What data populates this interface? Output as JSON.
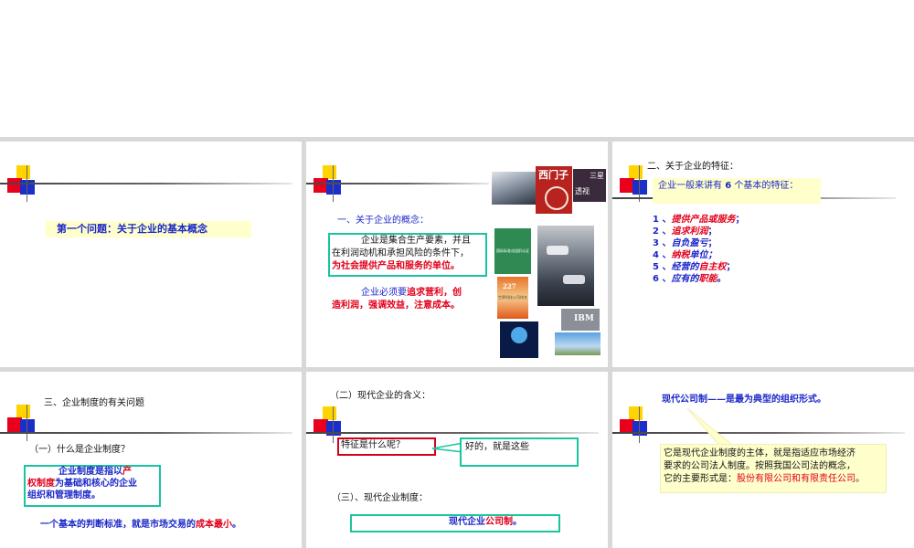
{
  "slides": {
    "s1": {
      "title": "第一个问题：关于企业的基本概念"
    },
    "s2": {
      "heading": "一、关于企业的概念：",
      "def_a": "企业是集合生产要素，并且",
      "def_b": "在利润动机和承担风险的条件下，",
      "def_c": "为社会提供产品和服务的单位。",
      "pursue_a1": "企业必须要",
      "pursue_a2": "追求营利，创",
      "pursue_b": "造利润，强调效益，注意成本。",
      "book_title": "西门子",
      "book_sub": "透视",
      "book_tag": "三星",
      "cert_text": "国际标准化组织认证",
      "cert2_text": "世界科技公司排名",
      "logo_text": "IBM"
    },
    "s3": {
      "heading": "二、关于企业的特征：",
      "intro_a": "企业一般来讲有",
      "intro_num": "6",
      "intro_b": "个基本的特征：",
      "features": [
        {
          "num": "1",
          "sep": "、",
          "label": "提供产品或服务",
          "tail": "；"
        },
        {
          "num": "2",
          "sep": "、",
          "label": "追求利润",
          "tail": "；"
        },
        {
          "num": "3",
          "sep": "、",
          "label": "自负盈亏",
          "tail": "；"
        },
        {
          "num": "4",
          "sep": "、",
          "label": "纳税",
          "tail": "单位；"
        },
        {
          "num": "5",
          "sep": "、",
          "label": "经营的",
          "label2": "自主权",
          "tail": "；"
        },
        {
          "num": "6",
          "sep": "、",
          "label": "应有的",
          "label2": "职能",
          "tail": "。"
        }
      ]
    },
    "s4": {
      "heading": "三、企业制度的有关问题",
      "q": "（一）什么是企业制度？",
      "def_a1": "企业制度是指以",
      "def_a2": "产",
      "def_b1": "权制度",
      "def_b2": "为基础和核心的企业",
      "def_c": "组织和管理制度。",
      "std_a": "一个基本的判断标准，就是市场交易的",
      "std_b": "成本最小",
      "std_c": "。"
    },
    "s5": {
      "heading": "（二）现代企业的含义：",
      "question": "特征是什么呢？",
      "answer": "好的，就是这些",
      "sub": "（三）、现代企业制度：",
      "box_a": "现代企业",
      "box_b": "公司制",
      "box_c": "。"
    },
    "s6": {
      "heading": "现代公司制——是最为典型的组织形式。",
      "body_a": "它是现代企业制度的主体，就是指适应市场经济",
      "body_b": "要求的公司法人制度。按照我国公司法的概念，",
      "body_c1": "它的主要形式是：",
      "body_c2": "股份有限公司和有限责任公司",
      "body_c3": "。"
    }
  }
}
